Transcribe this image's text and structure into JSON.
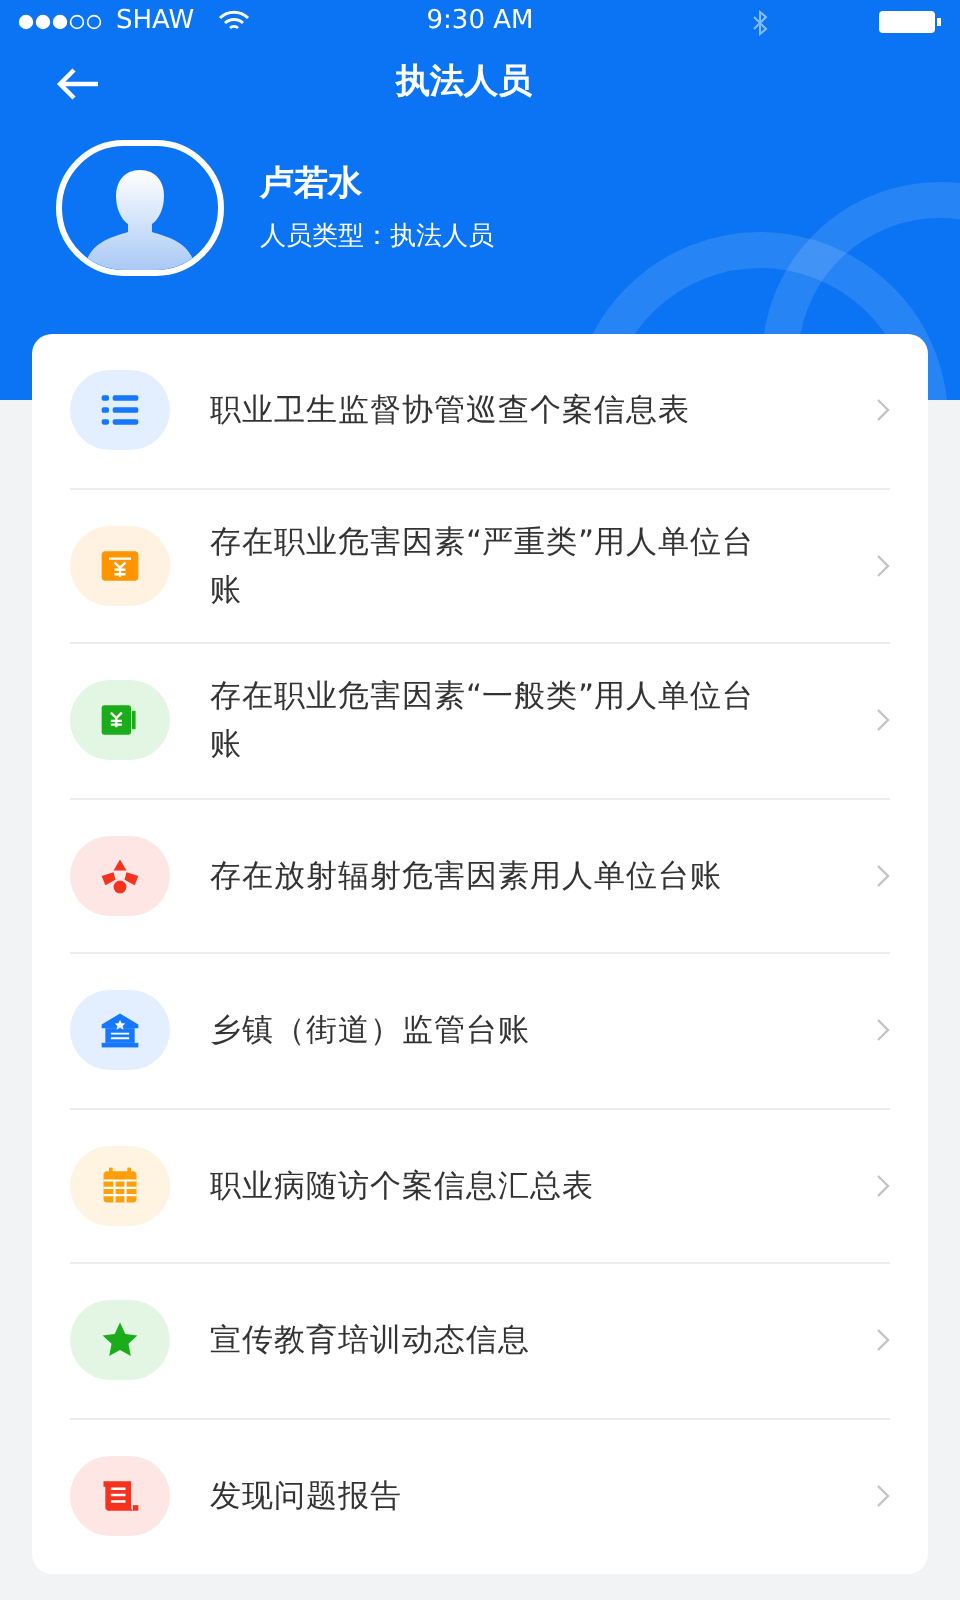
{
  "status_bar": {
    "carrier": "SHAW",
    "time": "9:30 AM"
  },
  "nav": {
    "title": "执法人员"
  },
  "profile": {
    "name": "卢若水",
    "type_label": "人员类型：执法人员"
  },
  "items": [
    {
      "kind": "list",
      "color": "#1677ff",
      "label": "职业卫生监督协管巡查个案信息表"
    },
    {
      "kind": "money",
      "color": "#ff9500",
      "label": "存在职业危害因素“严重类”用人单位台账"
    },
    {
      "kind": "wallet",
      "color": "#1aad19",
      "label": "存在职业危害因素“一般类”用人单位台账"
    },
    {
      "kind": "radiation",
      "color": "#f5321e",
      "label": "存在放射辐射危害因素用人单位台账"
    },
    {
      "kind": "bank",
      "color": "#1677ff",
      "label": "乡镇（街道）监管台账"
    },
    {
      "kind": "calendar",
      "color": "#ff9f0a",
      "label": "职业病随访个案信息汇总表"
    },
    {
      "kind": "star",
      "color": "#1aad19",
      "label": "宣传教育培训动态信息"
    },
    {
      "kind": "report",
      "color": "#f5321e",
      "label": "发现问题报告"
    }
  ]
}
